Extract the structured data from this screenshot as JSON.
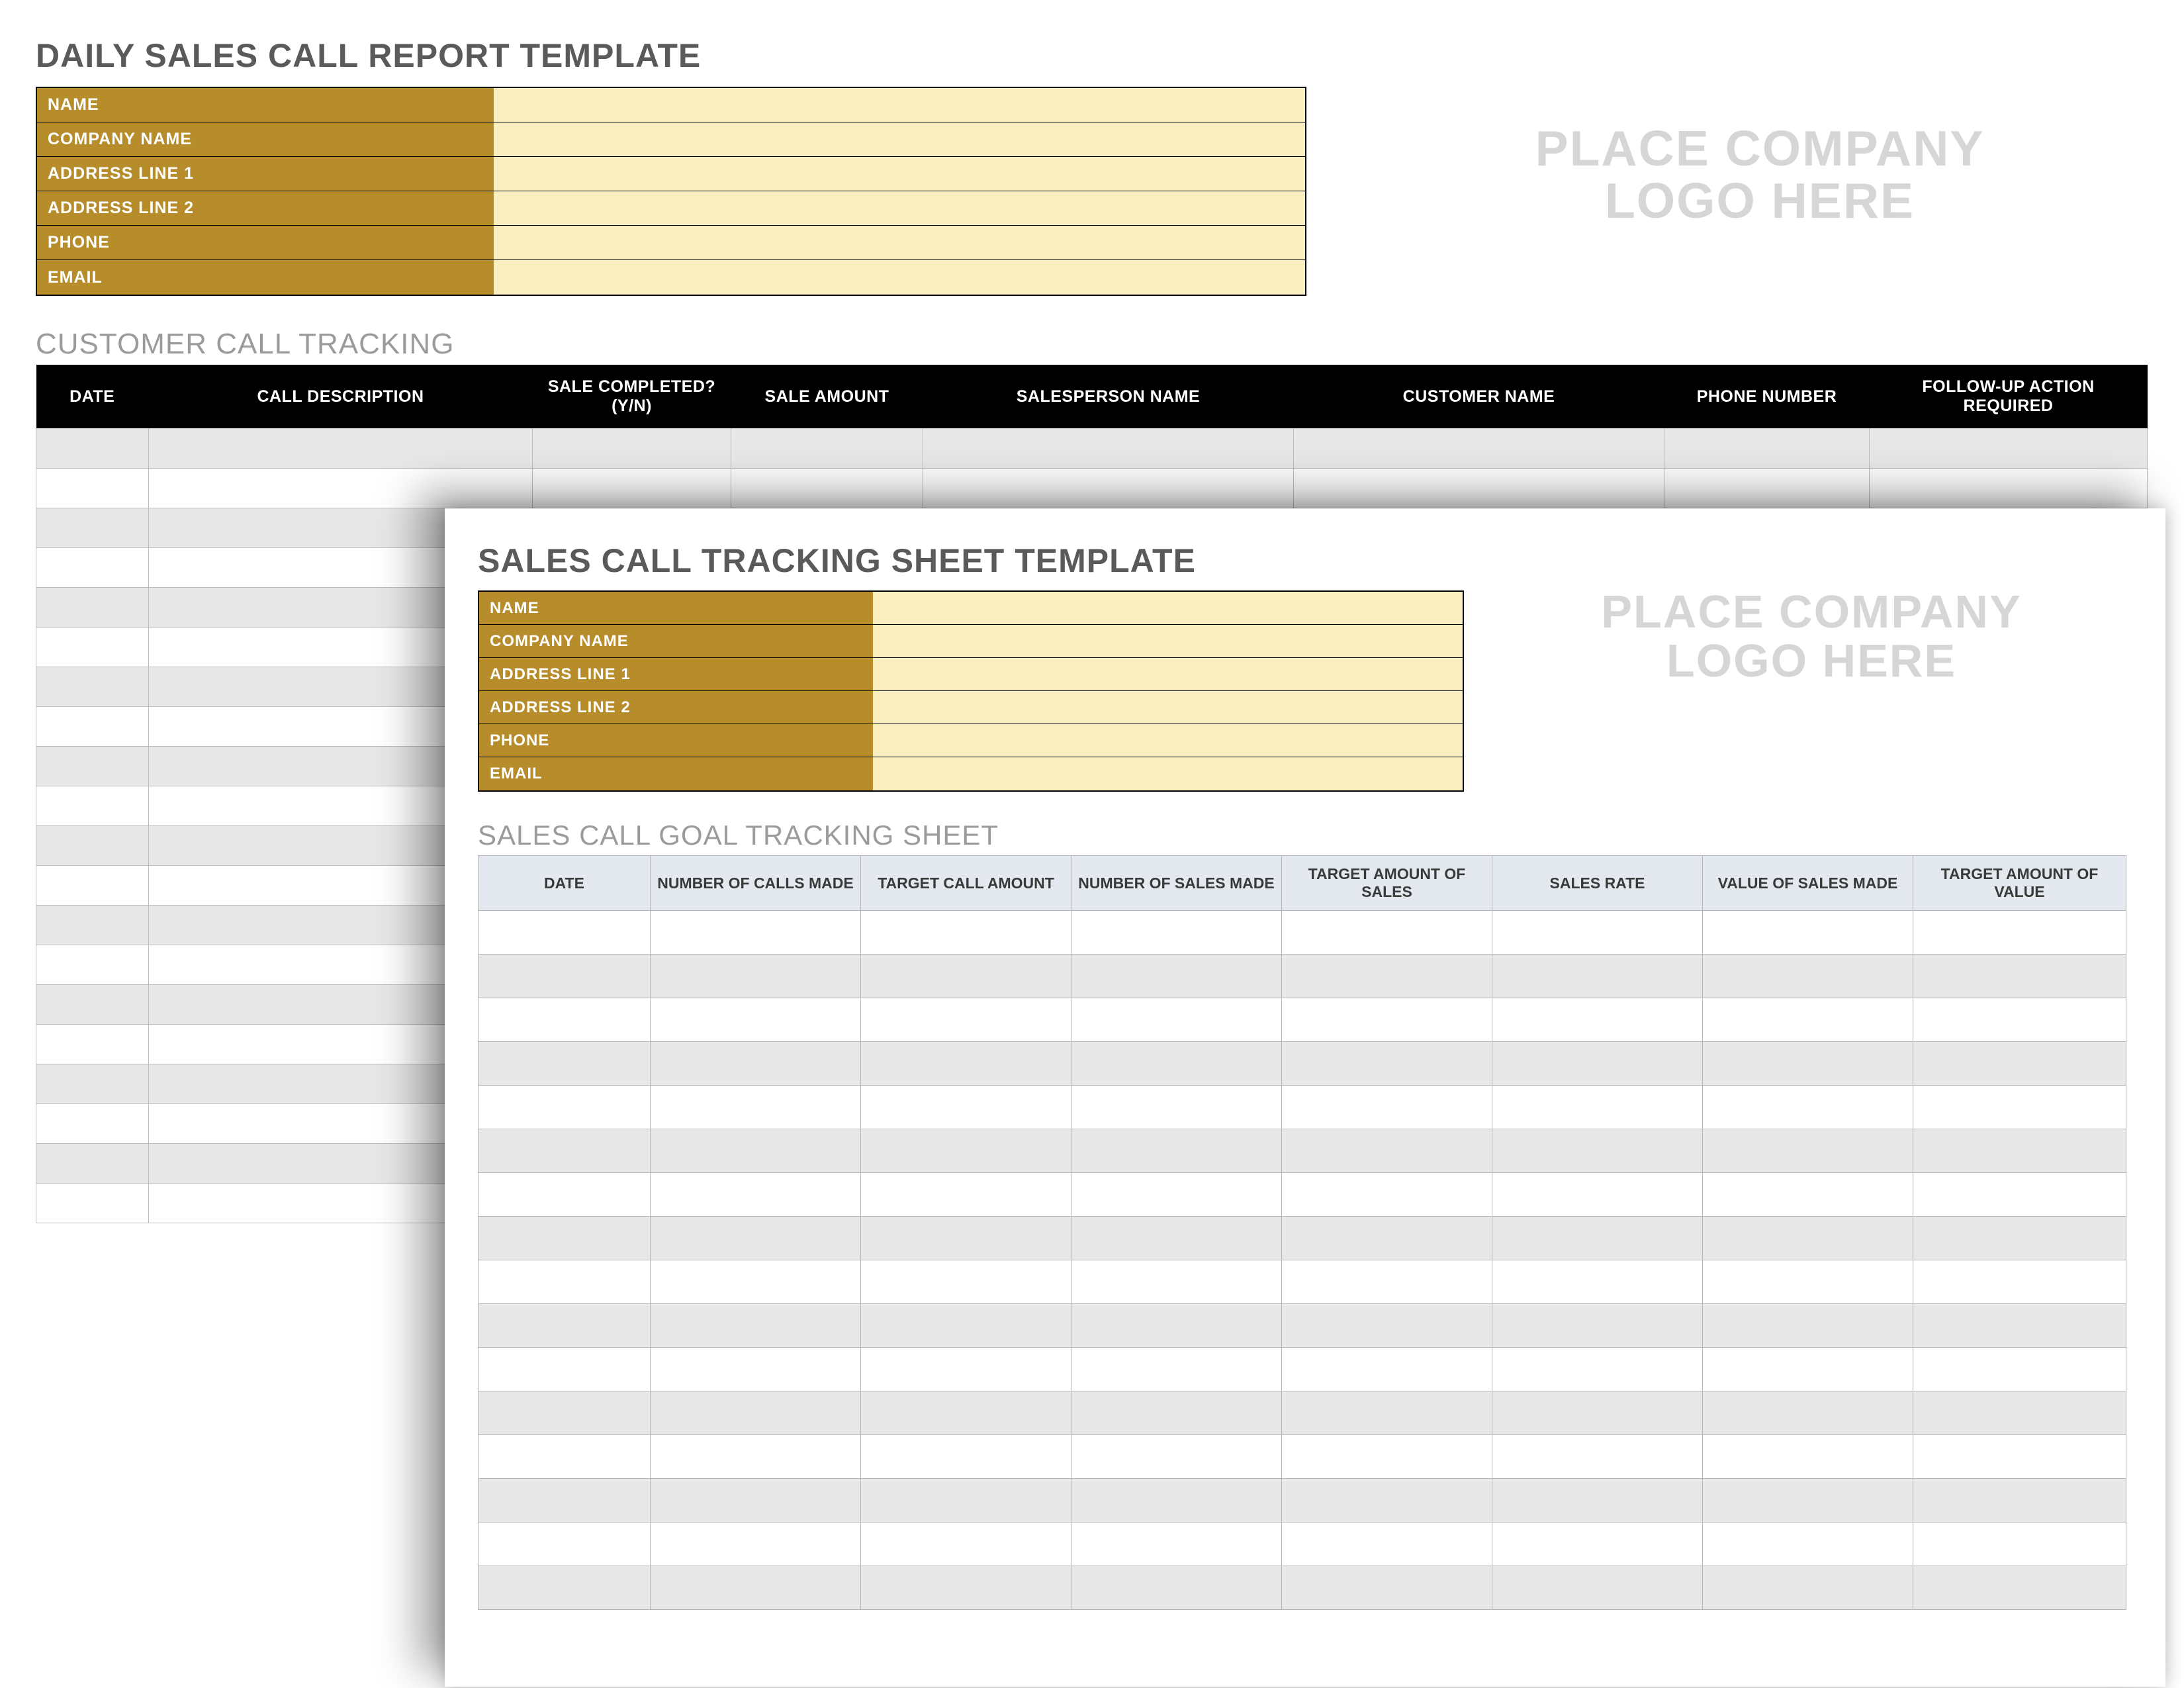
{
  "back": {
    "title": "DAILY SALES CALL REPORT TEMPLATE",
    "info_labels": [
      "NAME",
      "COMPANY NAME",
      "ADDRESS LINE 1",
      "ADDRESS LINE 2",
      "PHONE",
      "EMAIL"
    ],
    "info_values": [
      "",
      "",
      "",
      "",
      "",
      ""
    ],
    "logo_placeholder_line1": "PLACE COMPANY",
    "logo_placeholder_line2": "LOGO HERE",
    "subheading": "CUSTOMER CALL TRACKING",
    "columns": [
      "DATE",
      "CALL DESCRIPTION",
      "SALE COMPLETED? (Y/N)",
      "SALE AMOUNT",
      "SALESPERSON NAME",
      "CUSTOMER NAME",
      "PHONE NUMBER",
      "FOLLOW-UP ACTION REQUIRED"
    ],
    "row_count": 20
  },
  "front": {
    "title": "SALES CALL TRACKING SHEET TEMPLATE",
    "info_labels": [
      "NAME",
      "COMPANY NAME",
      "ADDRESS LINE 1",
      "ADDRESS LINE 2",
      "PHONE",
      "EMAIL"
    ],
    "info_values": [
      "",
      "",
      "",
      "",
      "",
      ""
    ],
    "logo_placeholder_line1": "PLACE COMPANY",
    "logo_placeholder_line2": "LOGO HERE",
    "subheading": "SALES CALL GOAL TRACKING SHEET",
    "columns": [
      "DATE",
      "NUMBER OF CALLS MADE",
      "TARGET CALL AMOUNT",
      "NUMBER OF SALES MADE",
      "TARGET AMOUNT OF SALES",
      "SALES RATE",
      "VALUE OF SALES MADE",
      "TARGET AMOUNT OF VALUE"
    ],
    "row_count": 16
  }
}
